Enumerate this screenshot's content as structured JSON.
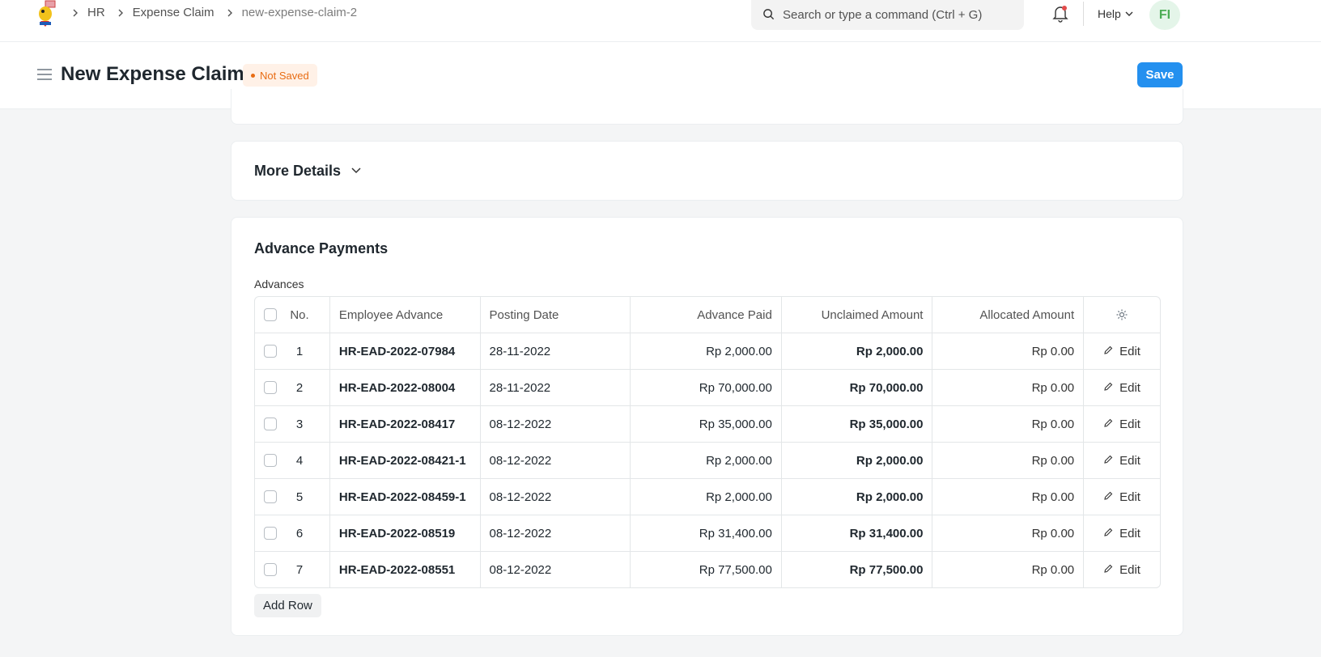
{
  "navbar": {
    "breadcrumbs": [
      "HR",
      "Expense Claim",
      "new-expense-claim-2"
    ],
    "search_placeholder": "Search or type a command (Ctrl + G)",
    "help_label": "Help",
    "avatar_initials": "FI"
  },
  "page": {
    "title": "New Expense Claim",
    "status": "Not Saved",
    "save_label": "Save"
  },
  "more_details": {
    "title": "More Details"
  },
  "advance_payments": {
    "title": "Advance Payments",
    "table_label": "Advances",
    "columns": [
      "No.",
      "Employee Advance",
      "Posting Date",
      "Advance Paid",
      "Unclaimed Amount",
      "Allocated Amount"
    ],
    "rows": [
      {
        "no": "1",
        "employee_advance": "HR-EAD-2022-07984",
        "posting_date": "28-11-2022",
        "advance_paid": "Rp 2,000.00",
        "unclaimed_amount": "Rp 2,000.00",
        "allocated_amount": "Rp 0.00"
      },
      {
        "no": "2",
        "employee_advance": "HR-EAD-2022-08004",
        "posting_date": "28-11-2022",
        "advance_paid": "Rp 70,000.00",
        "unclaimed_amount": "Rp 70,000.00",
        "allocated_amount": "Rp 0.00"
      },
      {
        "no": "3",
        "employee_advance": "HR-EAD-2022-08417",
        "posting_date": "08-12-2022",
        "advance_paid": "Rp 35,000.00",
        "unclaimed_amount": "Rp 35,000.00",
        "allocated_amount": "Rp 0.00"
      },
      {
        "no": "4",
        "employee_advance": "HR-EAD-2022-08421-1",
        "posting_date": "08-12-2022",
        "advance_paid": "Rp 2,000.00",
        "unclaimed_amount": "Rp 2,000.00",
        "allocated_amount": "Rp 0.00"
      },
      {
        "no": "5",
        "employee_advance": "HR-EAD-2022-08459-1",
        "posting_date": "08-12-2022",
        "advance_paid": "Rp 2,000.00",
        "unclaimed_amount": "Rp 2,000.00",
        "allocated_amount": "Rp 0.00"
      },
      {
        "no": "6",
        "employee_advance": "HR-EAD-2022-08519",
        "posting_date": "08-12-2022",
        "advance_paid": "Rp 31,400.00",
        "unclaimed_amount": "Rp 31,400.00",
        "allocated_amount": "Rp 0.00"
      },
      {
        "no": "7",
        "employee_advance": "HR-EAD-2022-08551",
        "posting_date": "08-12-2022",
        "advance_paid": "Rp 77,500.00",
        "unclaimed_amount": "Rp 77,500.00",
        "allocated_amount": "Rp 0.00"
      }
    ],
    "edit_label": "Edit",
    "add_row_label": "Add Row"
  },
  "colors": {
    "primary": "#2490ef",
    "not_saved": "#e86c13",
    "avatar": "#4cad55",
    "notification_dot": "#e24c4c"
  },
  "icons": [
    "app-logo-icon",
    "chevron-right-icon",
    "search-icon",
    "bell-icon",
    "chevron-down-icon",
    "hamburger-icon",
    "gear-icon",
    "pencil-icon"
  ]
}
